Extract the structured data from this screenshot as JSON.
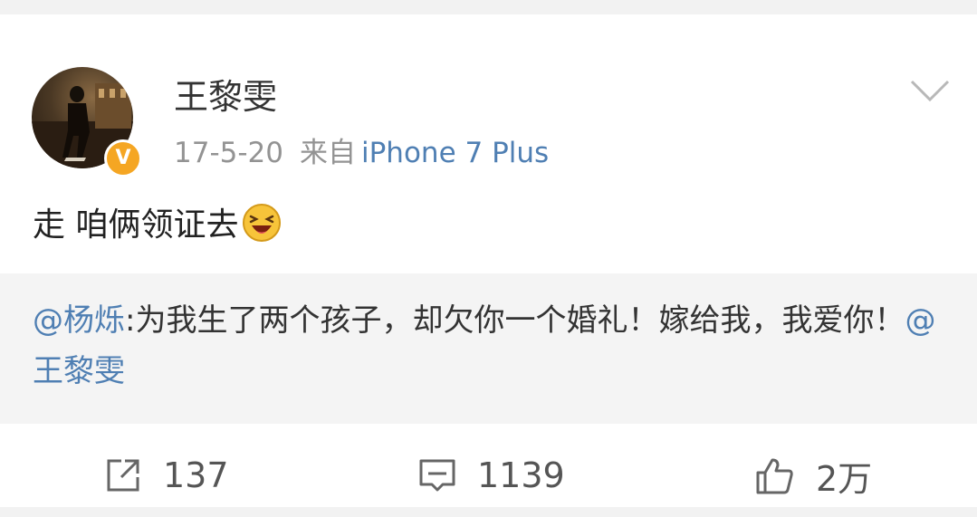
{
  "post": {
    "username": "王黎雯",
    "date": "17-5-20",
    "from_label": "来自",
    "device": "iPhone 7 Plus",
    "text": "走 咱俩领证去",
    "emoji": "laughing-face"
  },
  "repost": {
    "mention_user": "@杨烁",
    "text": ":为我生了两个孩子，却欠你一个婚礼！嫁给我，我爱你！",
    "mention_tail": "@王黎雯"
  },
  "actions": {
    "share_count": "137",
    "comment_count": "1139",
    "like_count": "2万"
  },
  "colors": {
    "link": "#4f7fb3",
    "badge": "#f5a623",
    "repost_bg": "#f4f4f4"
  }
}
